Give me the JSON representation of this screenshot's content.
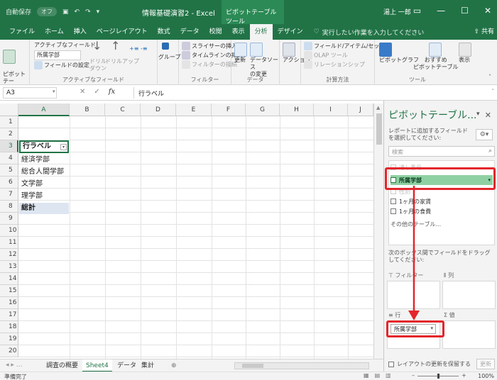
{
  "window": {
    "autosave": "自動保存",
    "autosave_toggle": "オフ",
    "title": "情報基礎演習2 - Excel",
    "context_tab": "ピボットテーブル ツール",
    "user": "湯上 一郎",
    "share": "共有"
  },
  "ribbon_tabs": [
    {
      "label": "ファイル"
    },
    {
      "label": "ホーム"
    },
    {
      "label": "挿入"
    },
    {
      "label": "ページレイアウト"
    },
    {
      "label": "数式"
    },
    {
      "label": "データ"
    },
    {
      "label": "校閲"
    },
    {
      "label": "表示"
    },
    {
      "label": "分析"
    },
    {
      "label": "デザイン"
    }
  ],
  "tell_me": "実行したい作業を入力してください",
  "ribbon": {
    "pivot_btn": "ピボットテー\nブル",
    "active_field_label": "アクティブなフィールド:",
    "active_field_value": "所属学部",
    "field_settings": "フィールドの設定",
    "drill_down": "ドリル\nダウン",
    "drill_up": "ドリルアップ",
    "group": "グループ",
    "group_active_field": "アクティブなフィールド",
    "insert_slicer": "スライサーの挿入",
    "insert_timeline": "タイムラインの挿入",
    "filter_connections": "フィルターの接続",
    "group_filter": "フィルター",
    "refresh": "更新",
    "change_source": "データソース\nの変更",
    "group_data": "データ",
    "action": "アクション",
    "fields_items": "フィールド/アイテム/セット",
    "olap": "OLAP ツール",
    "relationships": "リレーションシップ",
    "group_calc": "計算方法",
    "pivot_chart": "ピボットグラフ",
    "recommended": "おすすめ\nピボットテーブル",
    "show": "表示",
    "group_tools": "ツール"
  },
  "formula_bar": {
    "name_box": "A3",
    "formula": "行ラベル"
  },
  "sheet": {
    "columns": [
      "A",
      "B",
      "C",
      "D",
      "E",
      "F",
      "G",
      "H",
      "I",
      "J"
    ],
    "rows": [
      "1",
      "2",
      "3",
      "4",
      "5",
      "6",
      "7",
      "8",
      "9",
      "10",
      "11",
      "12",
      "13",
      "14",
      "15",
      "16",
      "17",
      "18",
      "19",
      "20"
    ],
    "selected_cell": "A3",
    "pivot": {
      "header": "行ラベル",
      "items": [
        "経済学部",
        "総合人間学部",
        "文学部",
        "理学部"
      ],
      "total": "総計"
    }
  },
  "sheet_tabs": [
    {
      "label": "調査の概要",
      "active": false
    },
    {
      "label": "Sheet4",
      "active": true
    },
    {
      "label": "データ",
      "active": false
    },
    {
      "label": "集計",
      "active": false
    }
  ],
  "status": {
    "ready": "準備完了",
    "zoom": "100%"
  },
  "pivot_pane": {
    "title": "ピボットテーブル...",
    "instruction": "レポートに追加するフィールドを選択してください:",
    "search_placeholder": "検索",
    "fields": [
      {
        "label": "通し番号",
        "state": "faded"
      },
      {
        "label": "所属学部",
        "state": "dragging"
      },
      {
        "label": "性別",
        "state": "faded"
      },
      {
        "label": "1ヶ月の家賃",
        "state": "normal"
      },
      {
        "label": "1ヶ月の食費",
        "state": "normal"
      }
    ],
    "more_tables": "その他のテーブル...",
    "drag_instruction": "次のボックス間でフィールドをドラッグしてください:",
    "areas": {
      "filter": "フィルター",
      "columns": "列",
      "rows": "行",
      "values": "値"
    },
    "rows_chip": "所属学部",
    "defer_update": "レイアウトの更新を保留する",
    "update": "更新"
  },
  "colors": {
    "excel_green": "#217346",
    "highlight_red": "#e3262b",
    "drag_field_bg": "#8fd0a3",
    "total_row_bg": "#dde5f1"
  }
}
